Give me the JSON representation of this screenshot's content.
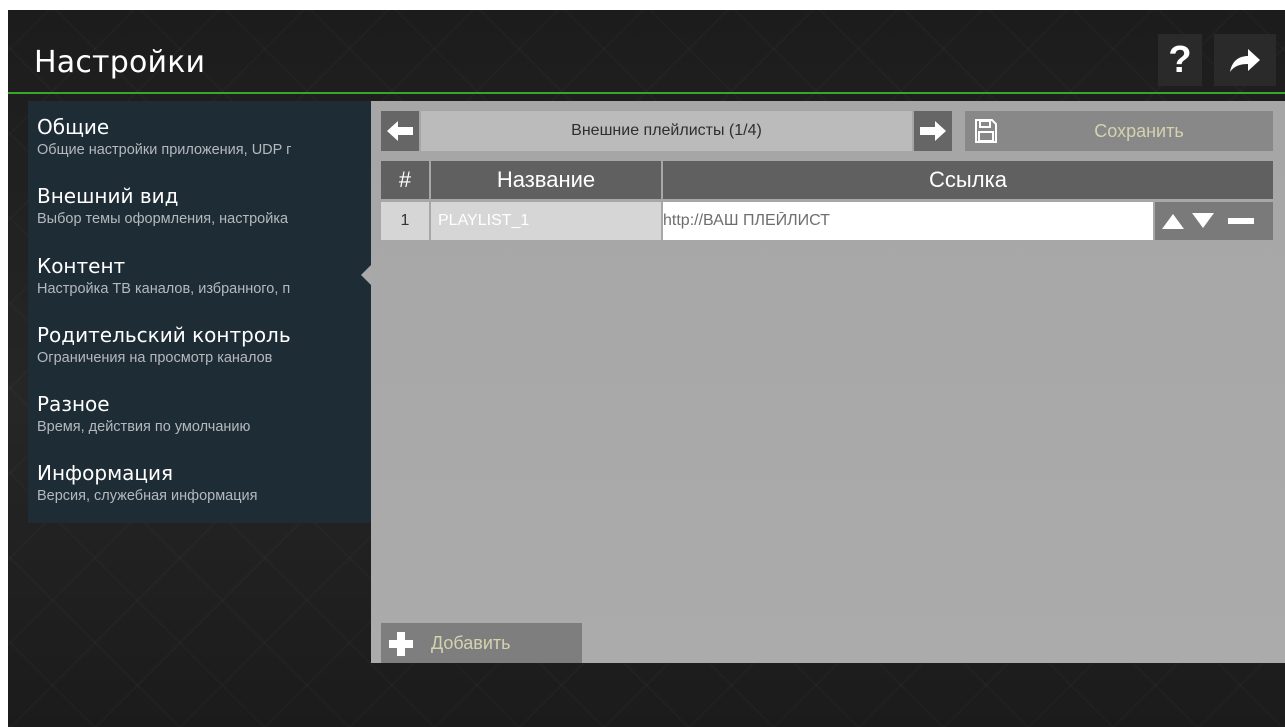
{
  "header": {
    "title": "Настройки",
    "help_icon": "question-mark-icon",
    "exit_icon": "arrow-right-icon",
    "accent_color": "#3aa52c"
  },
  "sidebar": {
    "items": [
      {
        "title": "Общие",
        "subtitle": "Общие настройки приложения, UDP г"
      },
      {
        "title": "Внешний вид",
        "subtitle": "Выбор темы оформления, настройка"
      },
      {
        "title": "Контент",
        "subtitle": "Настройка ТВ каналов, избранного, п"
      },
      {
        "title": "Родительский контроль",
        "subtitle": "Ограничения на просмотр каналов"
      },
      {
        "title": "Разное",
        "subtitle": "Время, действия по умолчанию"
      },
      {
        "title": "Информация",
        "subtitle": "Версия, служебная информация"
      }
    ],
    "selected": "Контент"
  },
  "main": {
    "pager_label": "Внешние плейлисты (1/4)",
    "save_label": "Сохранить",
    "table": {
      "columns": [
        "#",
        "Название",
        "Ссылка"
      ],
      "rows": [
        {
          "num": "1",
          "name": "PLAYLIST_1",
          "link": "http://ВАШ ПЛЕЙЛИСТ"
        }
      ]
    },
    "add_label": "Добавить"
  }
}
